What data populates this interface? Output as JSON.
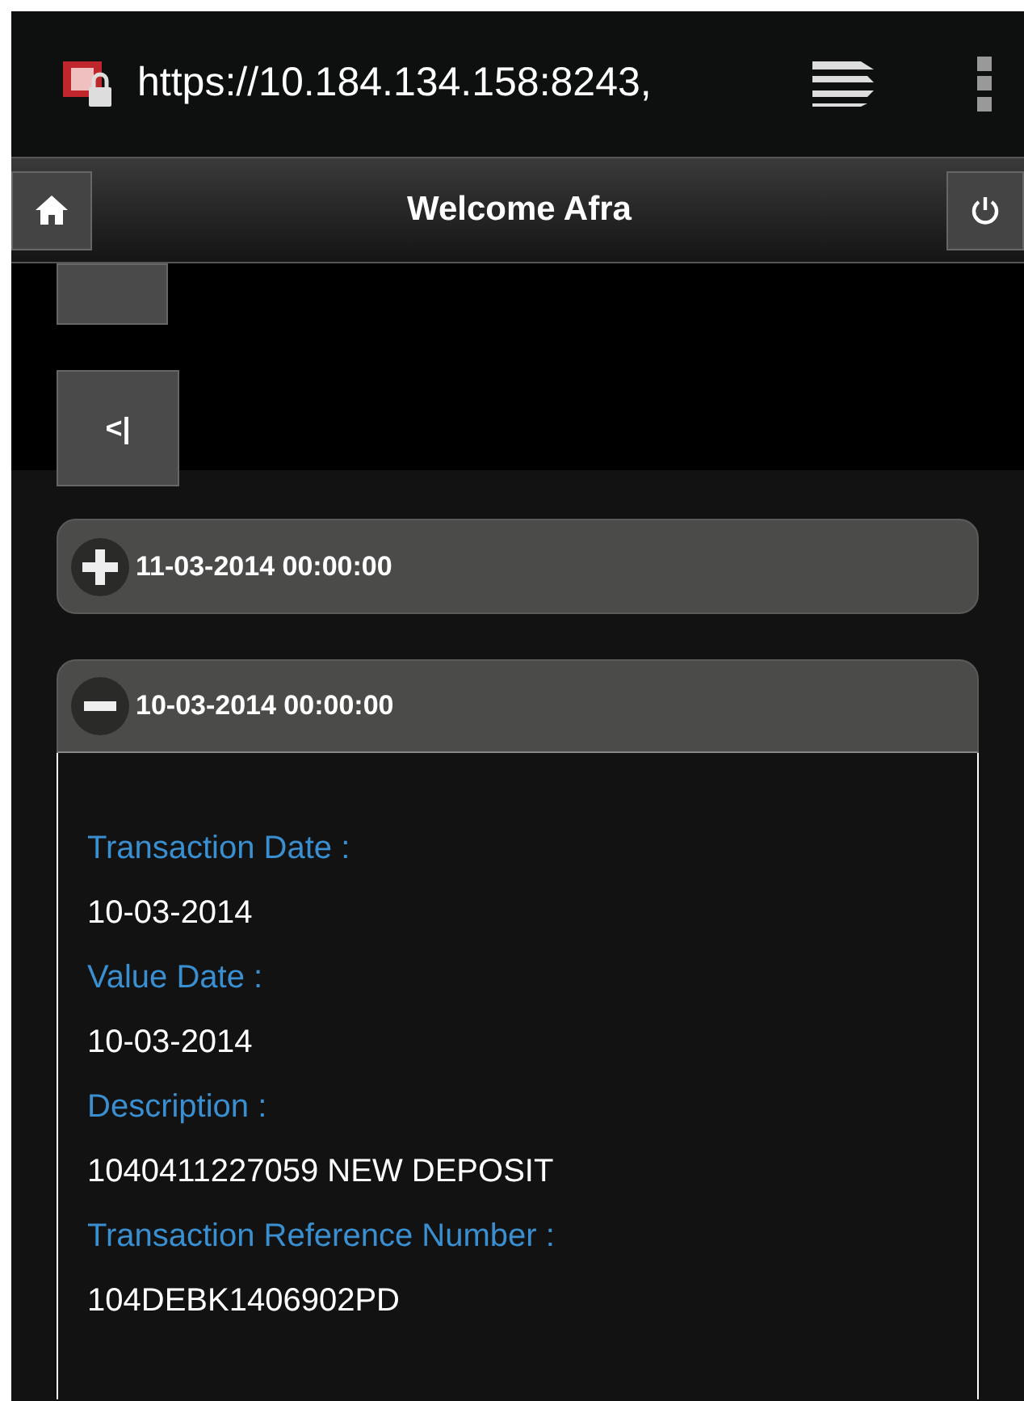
{
  "browser": {
    "url": "https://10.184.134.158:8243,"
  },
  "header": {
    "title": "Welcome Afra"
  },
  "pager": {
    "buttons": [
      {
        "label": "<|"
      }
    ]
  },
  "transactions": [
    {
      "date": "11-03-2014 00:00:00",
      "expanded": false
    },
    {
      "date": "10-03-2014 00:00:00",
      "expanded": true,
      "fields": [
        {
          "label": "Transaction Date :",
          "value": "10-03-2014"
        },
        {
          "label": "Value Date :",
          "value": "10-03-2014"
        },
        {
          "label": "Description :",
          "value": "1040411227059 NEW DEPOSIT"
        },
        {
          "label": "Transaction Reference Number :",
          "value": "104DEBK1406902PD"
        }
      ]
    }
  ]
}
